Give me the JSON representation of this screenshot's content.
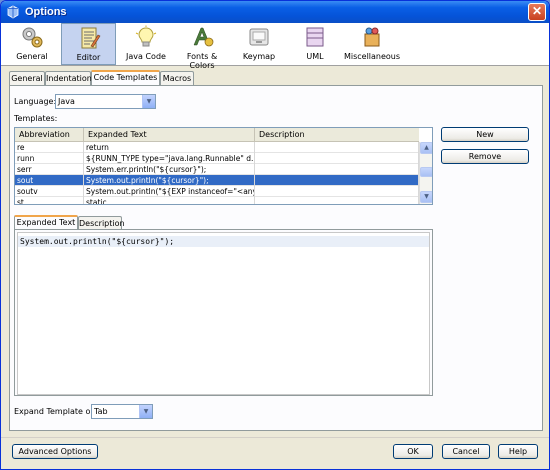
{
  "window": {
    "title": "Options"
  },
  "categories": [
    {
      "label": "General",
      "icon": "general-icon"
    },
    {
      "label": "Editor",
      "icon": "editor-icon"
    },
    {
      "label": "Java Code",
      "icon": "java-code-icon"
    },
    {
      "label": "Fonts & Colors",
      "icon": "fonts-colors-icon"
    },
    {
      "label": "Keymap",
      "icon": "keymap-icon"
    },
    {
      "label": "UML",
      "icon": "uml-icon"
    },
    {
      "label": "Miscellaneous",
      "icon": "miscellaneous-icon"
    }
  ],
  "editor_tabs": [
    "General",
    "Indentation",
    "Code Templates",
    "Macros"
  ],
  "language": {
    "label": "Language:",
    "value": "Java"
  },
  "templates": {
    "label": "Templates:",
    "columns": [
      "Abbreviation",
      "Expanded Text",
      "Description"
    ],
    "rows": [
      [
        "re",
        "return",
        ""
      ],
      [
        "runn",
        "${RUNN_TYPE type=\"java.lang.Runnable\" d...",
        ""
      ],
      [
        "serr",
        "System.err.println(\"${cursor}\");",
        ""
      ],
      [
        "sout",
        "System.out.println(\"${cursor}\");",
        ""
      ],
      [
        "soutv",
        "System.out.println(\"${EXP instanceof=\"<any...",
        ""
      ],
      [
        "st",
        "static",
        ""
      ]
    ],
    "selected_row": 3
  },
  "buttons": {
    "new": "New",
    "remove": "Remove"
  },
  "detail_tabs": [
    "Expanded Text",
    "Description"
  ],
  "editor_text": "System.out.println(\"${cursor}\");",
  "expand_on": {
    "label": "Expand Template on:",
    "value": "Tab"
  },
  "footer": {
    "advanced": "Advanced Options",
    "ok": "OK",
    "cancel": "Cancel",
    "help": "Help"
  },
  "colors": {
    "title_bar": "#0553d8",
    "selection": "#316ac5",
    "active_tab": "#f0a54b"
  }
}
